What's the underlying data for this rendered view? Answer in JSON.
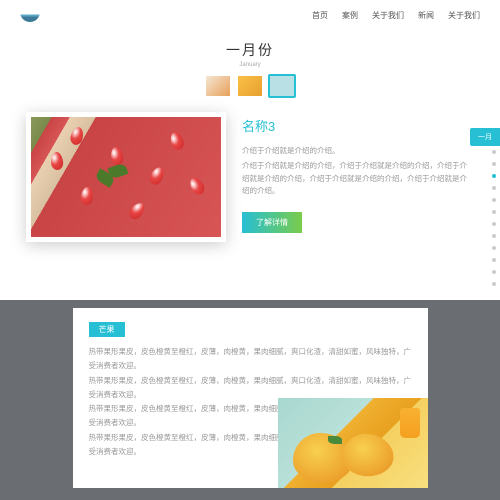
{
  "header": {
    "nav": [
      "首页",
      "案例",
      "关于我们",
      "新闻",
      "关于我们"
    ]
  },
  "monthSection": {
    "title": "一月份",
    "subtitle": "January"
  },
  "detail": {
    "name": "名称3",
    "desc1": "介绍于介绍就是介绍的介绍。",
    "desc2": "介绍于介绍就是介绍的介绍，介绍于介绍就是介绍的介绍，介绍于介绍就是介绍的介绍，介绍于介绍就是介绍的介绍，介绍于介绍就是介绍的介绍。",
    "button": "了解详情"
  },
  "sideTab": "一月",
  "modal": {
    "title": "芒果",
    "line1": "热带果形果皮，皮色橙黄至橙红，皮薄，肉橙黄，果肉细腻，爽口化渣，清甜如蜜，风味独特，广受消费者欢迎。",
    "line2": "热带果形果皮，皮色橙黄至橙红，皮薄，肉橙黄，果肉细腻，爽口化渣，清甜如蜜，风味独特，广受消费者欢迎。",
    "line3": "热带果形果皮，皮色橙黄至橙红，皮薄，肉橙黄，果肉细腻，爽口化渣，清甜如蜜，风味独特，广受消费者欢迎。",
    "line4": "热带果形果皮，皮色橙黄至橙红，皮薄，肉橙黄，果肉细腻，爽口化渣，清甜如蜜，风味独特，广受消费者欢迎。"
  }
}
